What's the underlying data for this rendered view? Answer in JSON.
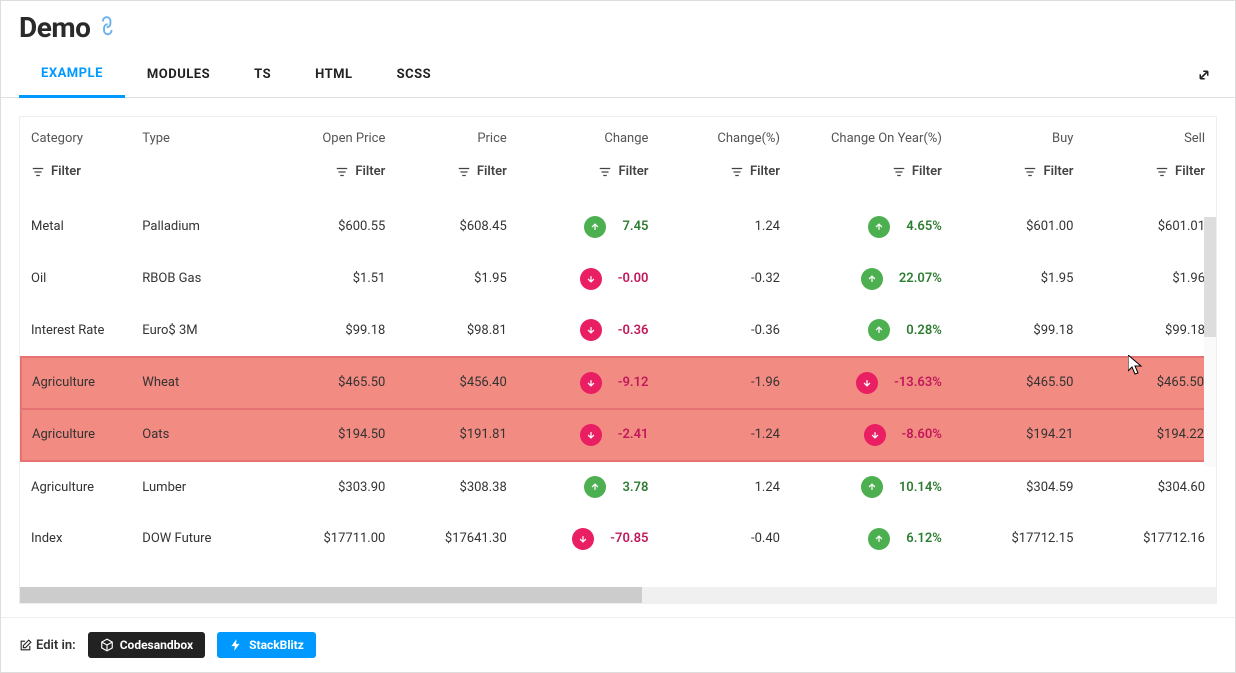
{
  "page_title": "Demo",
  "tabs": [
    "EXAMPLE",
    "MODULES",
    "TS",
    "HTML",
    "SCSS"
  ],
  "active_tab": 0,
  "filter_label": "Filter",
  "columns": [
    {
      "key": "category",
      "label": "Category",
      "align": "left",
      "filter": true
    },
    {
      "key": "type",
      "label": "Type",
      "align": "left",
      "filter": false
    },
    {
      "key": "open_price",
      "label": "Open Price",
      "align": "right",
      "filter": true
    },
    {
      "key": "price",
      "label": "Price",
      "align": "right",
      "filter": true
    },
    {
      "key": "change",
      "label": "Change",
      "align": "right",
      "filter": true
    },
    {
      "key": "change_pct",
      "label": "Change(%)",
      "align": "right",
      "filter": true
    },
    {
      "key": "change_year",
      "label": "Change On Year(%)",
      "align": "right",
      "filter": true
    },
    {
      "key": "buy",
      "label": "Buy",
      "align": "right",
      "filter": true
    },
    {
      "key": "sell",
      "label": "Sell",
      "align": "right",
      "filter": true
    }
  ],
  "rows": [
    {
      "category": "Metal",
      "type": "Palladium",
      "open_price": "$600.55",
      "price": "$608.45",
      "change": "7.45",
      "change_dir": "up",
      "change_pct": "1.24",
      "change_year": "4.65%",
      "year_dir": "up",
      "buy": "$601.00",
      "sell": "$601.01",
      "highlighted": false
    },
    {
      "category": "Oil",
      "type": "RBOB Gas",
      "open_price": "$1.51",
      "price": "$1.95",
      "change": "-0.00",
      "change_dir": "down",
      "change_pct": "-0.32",
      "change_year": "22.07%",
      "year_dir": "up",
      "buy": "$1.95",
      "sell": "$1.96",
      "highlighted": false
    },
    {
      "category": "Interest Rate",
      "type": "Euro$ 3M",
      "open_price": "$99.18",
      "price": "$98.81",
      "change": "-0.36",
      "change_dir": "down",
      "change_pct": "-0.36",
      "change_year": "0.28%",
      "year_dir": "up",
      "buy": "$99.18",
      "sell": "$99.18",
      "highlighted": false
    },
    {
      "category": "Agriculture",
      "type": "Wheat",
      "open_price": "$465.50",
      "price": "$456.40",
      "change": "-9.12",
      "change_dir": "down",
      "change_pct": "-1.96",
      "change_year": "-13.63%",
      "year_dir": "down",
      "buy": "$465.50",
      "sell": "$465.50",
      "highlighted": true
    },
    {
      "category": "Agriculture",
      "type": "Oats",
      "open_price": "$194.50",
      "price": "$191.81",
      "change": "-2.41",
      "change_dir": "down",
      "change_pct": "-1.24",
      "change_year": "-8.60%",
      "year_dir": "down",
      "buy": "$194.21",
      "sell": "$194.22",
      "highlighted": true
    },
    {
      "category": "Agriculture",
      "type": "Lumber",
      "open_price": "$303.90",
      "price": "$308.38",
      "change": "3.78",
      "change_dir": "up",
      "change_pct": "1.24",
      "change_year": "10.14%",
      "year_dir": "up",
      "buy": "$304.59",
      "sell": "$304.60",
      "highlighted": false
    },
    {
      "category": "Index",
      "type": "DOW Future",
      "open_price": "$17711.00",
      "price": "$17641.30",
      "change": "-70.85",
      "change_dir": "down",
      "change_pct": "-0.40",
      "change_year": "6.12%",
      "year_dir": "up",
      "buy": "$17712.15",
      "sell": "$17712.16",
      "highlighted": false
    }
  ],
  "footer": {
    "edit_label": "Edit in:",
    "codesandbox": "Codesandbox",
    "stackblitz": "StackBlitz"
  }
}
